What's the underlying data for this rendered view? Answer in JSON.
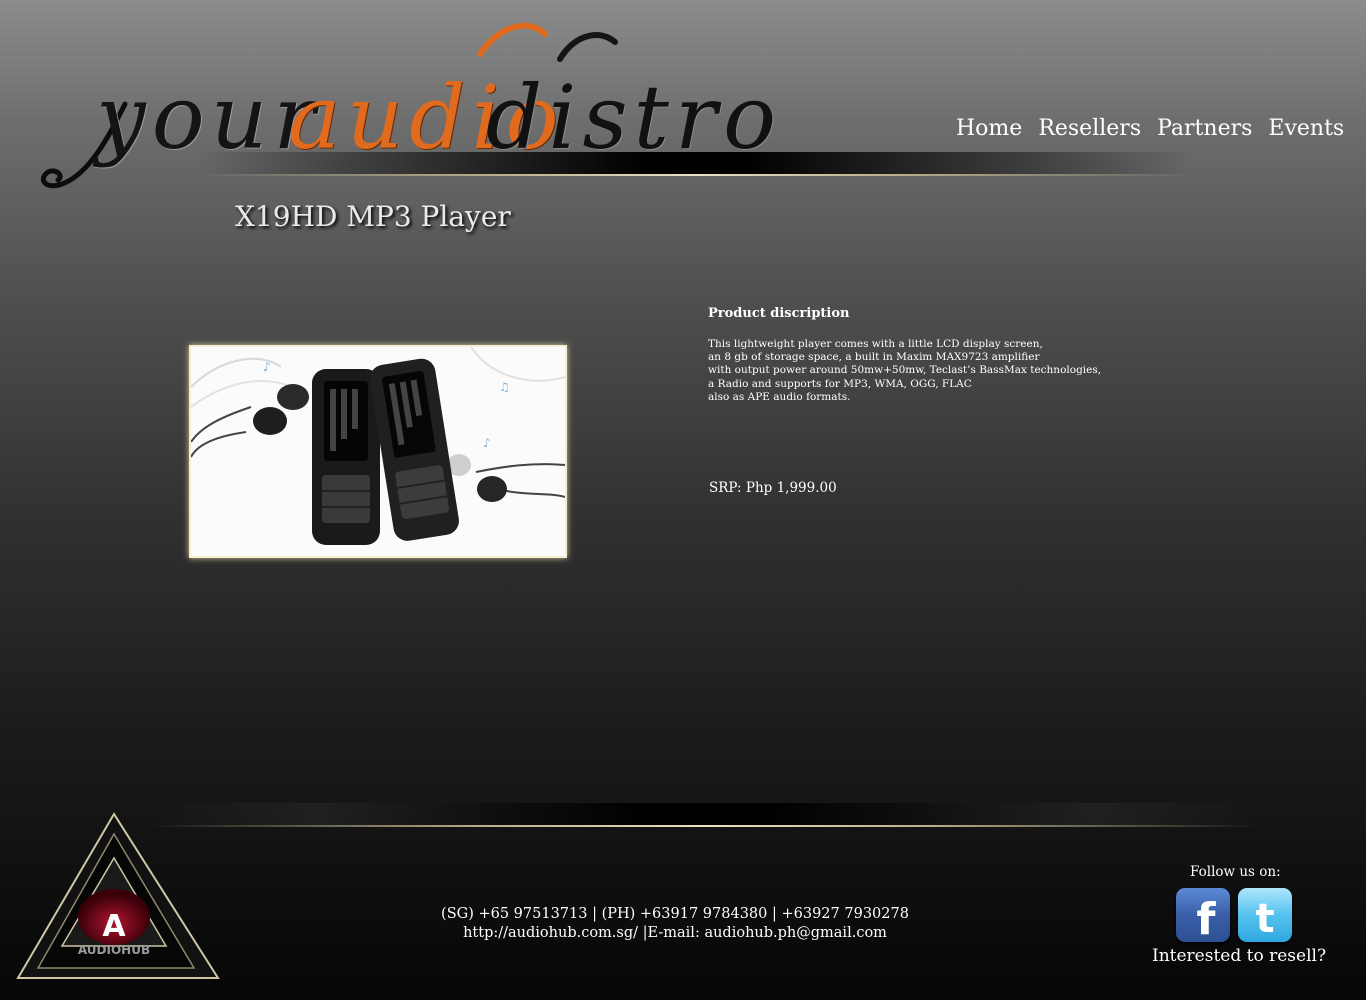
{
  "brand": {
    "logo_word_1": "your",
    "logo_word_2": "audio",
    "logo_word_3": "distro",
    "accent_color": "#e06a1d",
    "footer_logo_text": "AUDIOHUB",
    "footer_logo_letter": "A"
  },
  "nav": {
    "items": [
      {
        "label": "Home"
      },
      {
        "label": "Resellers"
      },
      {
        "label": "Partners"
      },
      {
        "label": "Events"
      }
    ]
  },
  "product": {
    "title": "X19HD MP3 Player",
    "description_heading": "Product discription",
    "description_lines": [
      "This lightweight player comes with a little LCD display screen,",
      "an 8 gb of storage space, a built in Maxim MAX9723 amplifier",
      "with output power around 50mw+50mw, Teclast’s BassMax technologies,",
      "a Radio and supports for MP3, WMA, OGG, FLAC",
      "also as APE audio formats."
    ],
    "srp": "SRP: Php 1,999.00"
  },
  "footer": {
    "contact_line_1": "(SG) +65 97513713  |  (PH) +63917 9784380  |  +63927 7930278",
    "contact_line_2": "http://audiohub.com.sg/  |E-mail: audiohub.ph@gmail.com",
    "follow_label": "Follow us on:",
    "social": [
      {
        "icon": "facebook-icon",
        "glyph": "f",
        "color": "#3b5998"
      },
      {
        "icon": "twitter-icon",
        "glyph": "t",
        "color": "#33b5e8"
      }
    ],
    "resell_text": "Interested to resell?"
  }
}
